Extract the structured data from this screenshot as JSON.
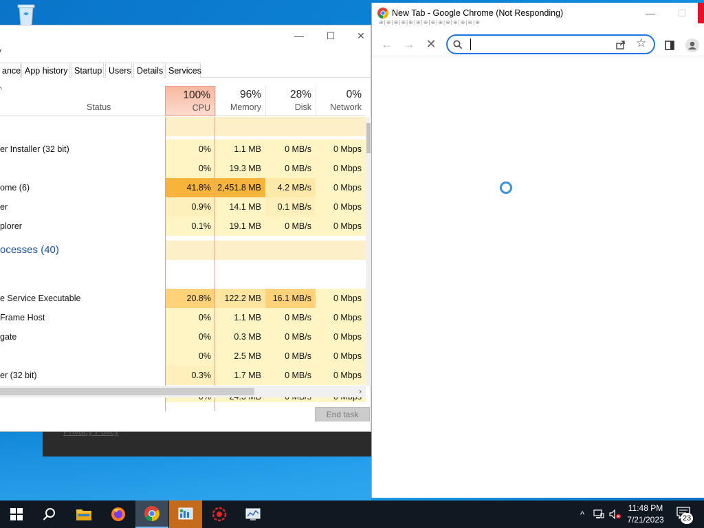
{
  "task_manager": {
    "menu_fragment": "v",
    "tabs": [
      "ance",
      "App history",
      "Startup",
      "Users",
      "Details",
      "Services"
    ],
    "columns": {
      "status": "Status",
      "cpu": {
        "pct": "100%",
        "label": "CPU"
      },
      "memory": {
        "pct": "96%",
        "label": "Memory"
      },
      "disk": {
        "pct": "28%",
        "label": "Disk"
      },
      "network": {
        "pct": "0%",
        "label": "Network"
      }
    },
    "rows": [
      {
        "name": "",
        "cpu": "",
        "mem": "",
        "disk": "",
        "net": ""
      },
      {
        "name": "er Installer (32 bit)",
        "cpu": "0%",
        "mem": "1.1 MB",
        "disk": "0 MB/s",
        "net": "0 Mbps"
      },
      {
        "name": "",
        "cpu": "0%",
        "mem": "19.3 MB",
        "disk": "0 MB/s",
        "net": "0 Mbps"
      },
      {
        "name": "ome (6)",
        "cpu": "41.8%",
        "mem": "2,451.8 MB",
        "disk": "4.2 MB/s",
        "net": "0 Mbps"
      },
      {
        "name": "er",
        "cpu": "0.9%",
        "mem": "14.1 MB",
        "disk": "0.1 MB/s",
        "net": "0 Mbps"
      },
      {
        "name": "plorer",
        "cpu": "0.1%",
        "mem": "19.1 MB",
        "disk": "0 MB/s",
        "net": "0 Mbps"
      }
    ],
    "group_label": "ocesses (40)",
    "bg_rows": [
      {
        "name": "e Service Executable",
        "cpu": "20.8%",
        "mem": "122.2 MB",
        "disk": "16.1 MB/s",
        "net": "0 Mbps"
      },
      {
        "name": "Frame Host",
        "cpu": "0%",
        "mem": "1.1 MB",
        "disk": "0 MB/s",
        "net": "0 Mbps"
      },
      {
        "name": "gate",
        "cpu": "0%",
        "mem": "0.3 MB",
        "disk": "0 MB/s",
        "net": "0 Mbps"
      },
      {
        "name": "",
        "cpu": "0%",
        "mem": "2.5 MB",
        "disk": "0 MB/s",
        "net": "0 Mbps"
      },
      {
        "name": "er (32 bit)",
        "cpu": "0.3%",
        "mem": "1.7 MB",
        "disk": "0 MB/s",
        "net": "0 Mbps"
      },
      {
        "name": "",
        "cpu": "0%",
        "mem": "24.3 MB",
        "disk": "0 MB/s",
        "net": "0 Mbps"
      }
    ],
    "end_task": "End task",
    "window_controls": {
      "minimize": "—",
      "maximize": "☐",
      "close": "✕"
    }
  },
  "behind_window": {
    "privacy_link": "Privacy Policy"
  },
  "chrome": {
    "title": "New Tab - Google Chrome (Not Responding)",
    "tabstrip_artifacts": "⊕|⊕|⊕|⊕|⊕|⊕|⊕|⊕|⊕|⊕|⊕|⊕|⊕|⊕",
    "omnibox_value": "",
    "omnibox_placeholder": "",
    "window_controls": {
      "minimize": "—",
      "maximize": "☐"
    }
  },
  "taskbar": {
    "clock_time": "11:48 PM",
    "clock_date": "7/21/2023",
    "notification_count": "23",
    "icons": [
      "windows-start",
      "search",
      "file-explorer",
      "firefox",
      "chrome",
      "task-manager-app",
      "red-app",
      "system-app"
    ]
  },
  "colors": {
    "desktop": "#0d86d8",
    "cpu_header": "#f8b8a0",
    "heat_low": "#fff4c4",
    "heat_mid": "#ffd27a",
    "heat_high": "#f7b43a",
    "omnibox_focus": "#1a73e8",
    "taskbar": "#101922"
  }
}
